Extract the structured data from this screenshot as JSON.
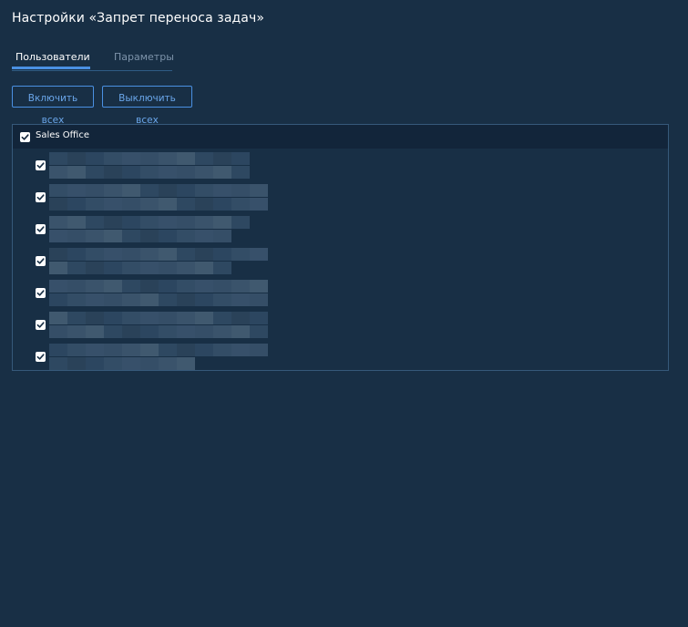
{
  "page": {
    "title": "Настройки «Запрет переноса задач»"
  },
  "tabs": [
    {
      "label": "Пользователи",
      "active": true
    },
    {
      "label": "Параметры",
      "active": false
    }
  ],
  "actions": {
    "enable_all_label": "Включить всех",
    "disable_all_label": "Выключить всех"
  },
  "group": {
    "label": "Sales Office",
    "checked": true
  },
  "users": [
    {
      "checked": true,
      "name_redacted": true
    },
    {
      "checked": true,
      "name_redacted": true
    },
    {
      "checked": true,
      "name_redacted": true
    },
    {
      "checked": true,
      "name_redacted": true
    },
    {
      "checked": true,
      "name_redacted": true
    },
    {
      "checked": true,
      "name_redacted": true
    },
    {
      "checked": true,
      "name_redacted": true
    }
  ],
  "colors": {
    "background": "#182f45",
    "accent": "#4a90e2",
    "group_row_background": "#12253a",
    "muted_text": "#7d93aa"
  },
  "icons": {
    "checkbox": "checkmark-icon"
  }
}
